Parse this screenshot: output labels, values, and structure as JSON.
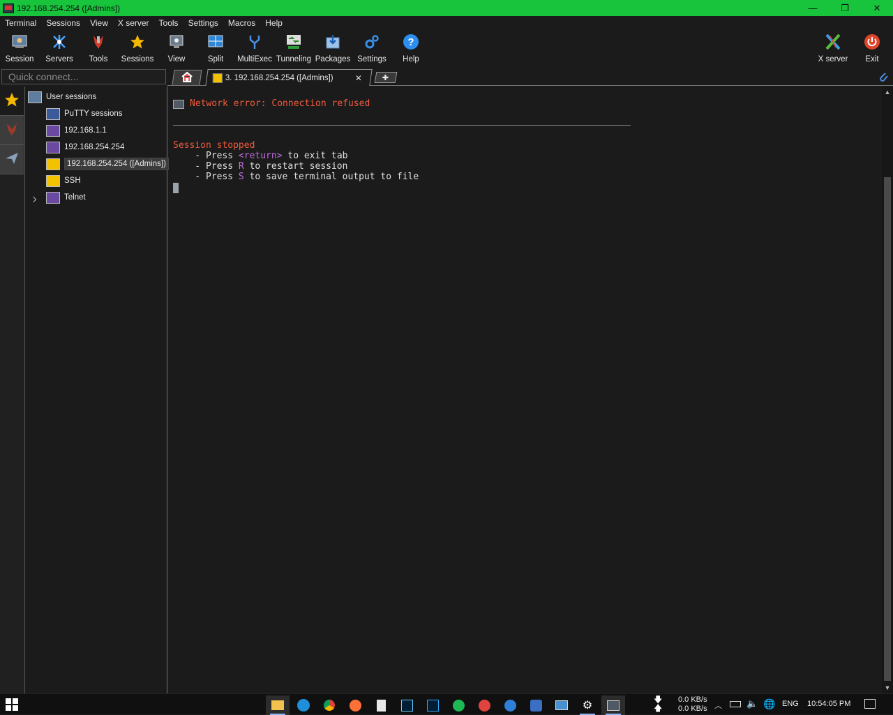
{
  "window": {
    "title": "192.168.254.254 ([Admins])",
    "title_color": "#17c43c",
    "minimize_glyph": "—",
    "restore_glyph": "❐",
    "close_glyph": "✕"
  },
  "menu": [
    "Terminal",
    "Sessions",
    "View",
    "X server",
    "Tools",
    "Settings",
    "Macros",
    "Help"
  ],
  "toolbar": {
    "items": [
      {
        "label": "Session",
        "icon": "session-icon"
      },
      {
        "label": "Servers",
        "icon": "servers-icon"
      },
      {
        "label": "Tools",
        "icon": "tools-icon"
      },
      {
        "label": "Sessions",
        "icon": "star-icon"
      },
      {
        "label": "View",
        "icon": "view-icon"
      },
      {
        "label": "Split",
        "icon": "split-icon"
      },
      {
        "label": "MultiExec",
        "icon": "multiexec-icon"
      },
      {
        "label": "Tunneling",
        "icon": "tunneling-icon"
      },
      {
        "label": "Packages",
        "icon": "packages-icon"
      },
      {
        "label": "Settings",
        "icon": "settings-icon"
      },
      {
        "label": "Help",
        "icon": "help-icon"
      }
    ],
    "right_items": [
      {
        "label": "X server",
        "icon": "x-server-icon"
      },
      {
        "label": "Exit",
        "icon": "power-icon"
      }
    ]
  },
  "quick_connect": {
    "placeholder": "Quick connect..."
  },
  "tabs": {
    "session_tab_label": "3. 192.168.254.254 ([Admins])",
    "close_glyph": "✕",
    "new_tab_glyph": "✚"
  },
  "sessions_tree": {
    "root": "User sessions",
    "items": [
      {
        "label": "PuTTY sessions",
        "icon": "putty-folder-icon"
      },
      {
        "label": "192.168.1.1",
        "icon": "putty-session-icon"
      },
      {
        "label": "192.168.254.254",
        "icon": "putty-session-icon"
      },
      {
        "label": "192.168.254.254 ([Admins])",
        "icon": "wrench-session-icon",
        "selected": true
      },
      {
        "label": "SSH",
        "icon": "wrench-session-icon"
      },
      {
        "label": "Telnet",
        "icon": "putty-session-icon"
      }
    ]
  },
  "terminal": {
    "error_message": "Network error: Connection refused",
    "stopped": "Session stopped",
    "hint_prefix": "    - Press ",
    "hint1_key": "<return>",
    "hint1_rest": " to exit tab",
    "hint2_key": "R",
    "hint2_rest": " to restart session",
    "hint3_key": "S",
    "hint3_rest": " to save terminal output to file",
    "colors": {
      "error": "#f05a3c",
      "key": "#c06de0",
      "text": "#e0e0e0"
    }
  },
  "taskbar": {
    "apps": [
      "file-explorer-icon",
      "edge-icon",
      "chrome-icon",
      "firefox-icon",
      "notepad-icon",
      "lightroom-icon",
      "photoshop-icon",
      "spotify-icon",
      "todoist-icon",
      "app-blue-icon",
      "ccleaner-icon",
      "remote-icon",
      "settings-gear-icon",
      "mobaxterm-icon"
    ],
    "net_down": "0.0 KB/s",
    "net_up": "0.0 KB/s",
    "language": "ENG",
    "time": "10:54:05 PM"
  }
}
